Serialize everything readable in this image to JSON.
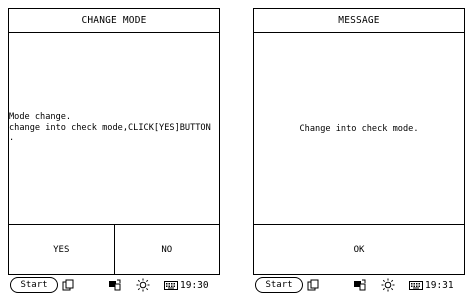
{
  "left_screen": {
    "title": "CHANGE MODE",
    "message_lines": [
      "Mode change.",
      "change into check mode,CLICK[YES]BUTTON",
      "."
    ],
    "buttons": {
      "yes": "YES",
      "no": "NO"
    },
    "taskbar": {
      "start": "Start",
      "time": "19:30"
    }
  },
  "right_screen": {
    "title": "MESSAGE",
    "message": "Change into check mode.",
    "buttons": {
      "ok": "OK"
    },
    "taskbar": {
      "start": "Start",
      "time": "19:31"
    }
  }
}
